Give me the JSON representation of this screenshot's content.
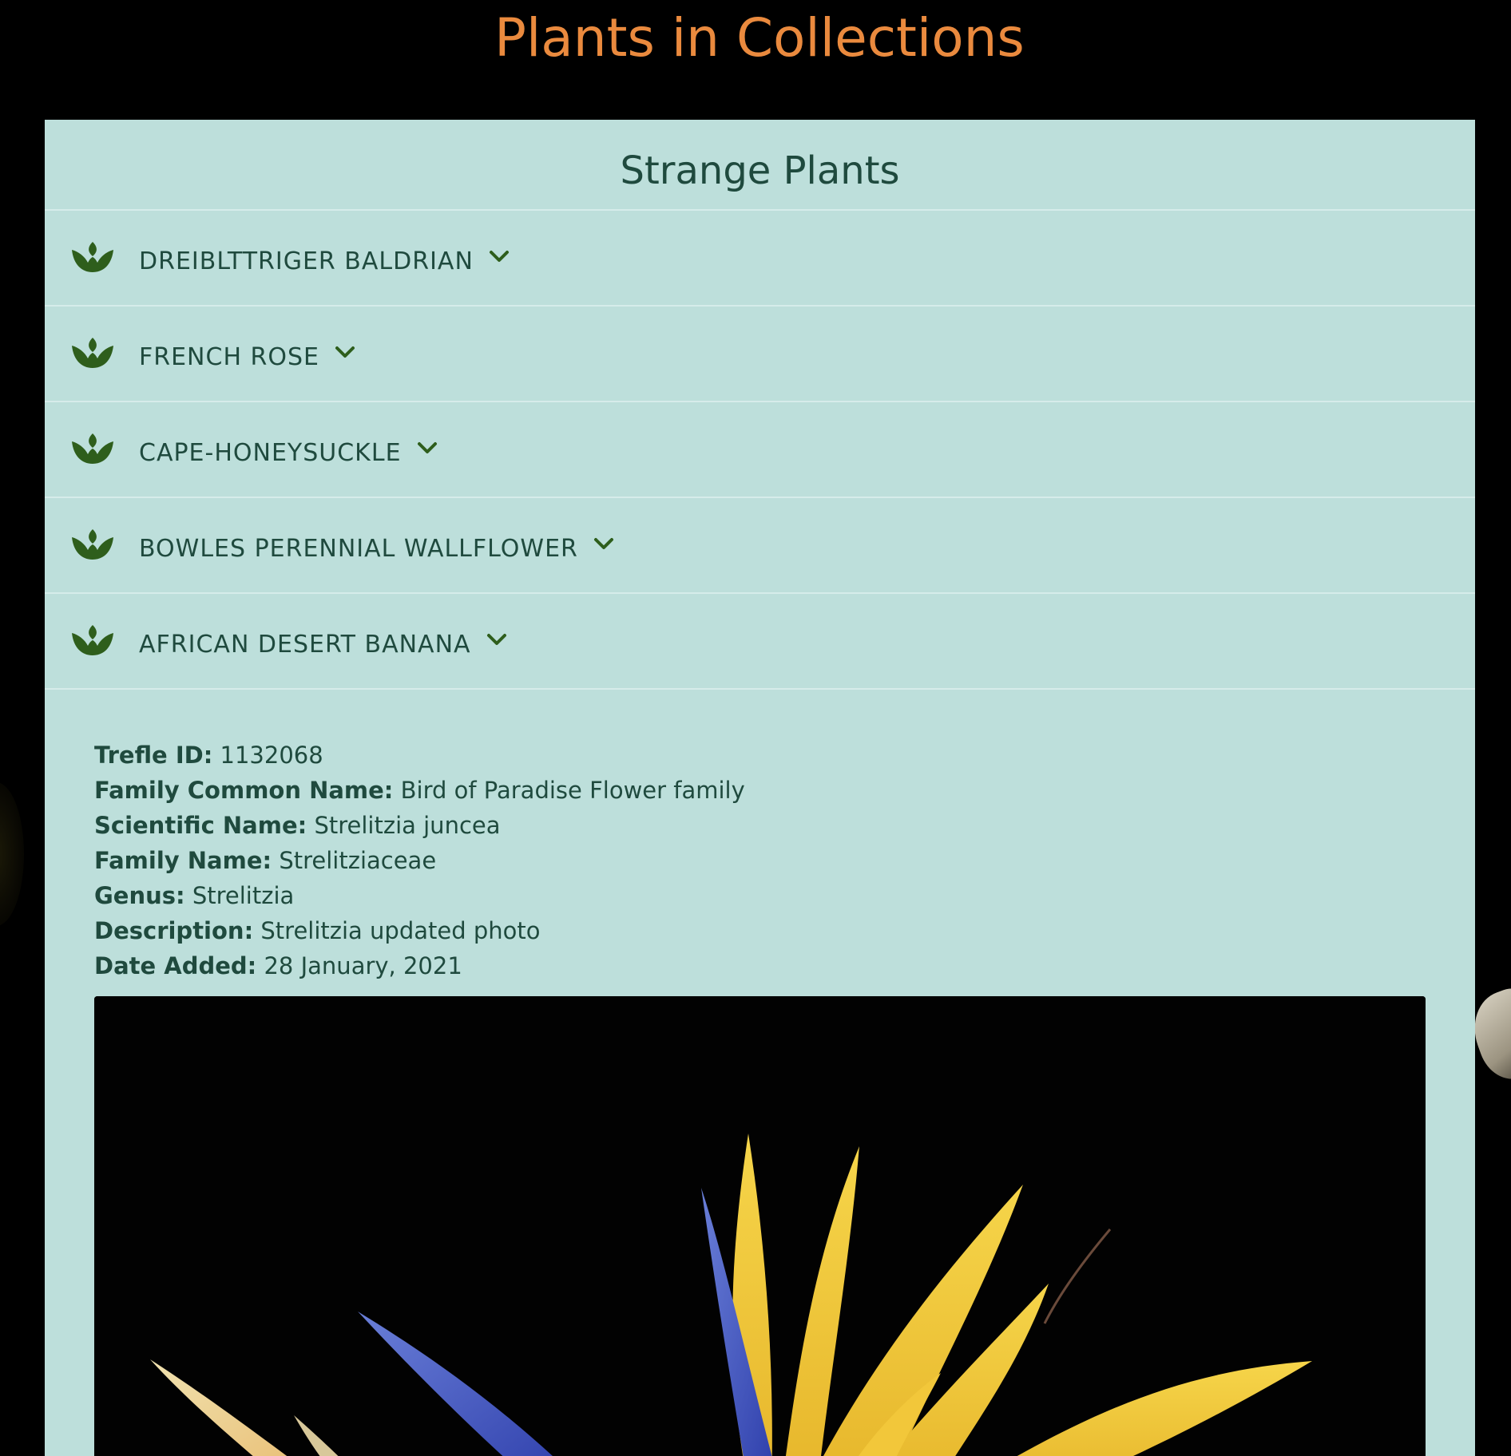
{
  "page": {
    "title": "Plants in Collections"
  },
  "collection": {
    "title": "Strange Plants",
    "items": [
      {
        "label": "DREIBLTTRIGER BALDRIAN",
        "icon": "plant-icon",
        "expanded": false
      },
      {
        "label": "FRENCH ROSE",
        "icon": "plant-icon",
        "expanded": false
      },
      {
        "label": "CAPE-HONEYSUCKLE",
        "icon": "plant-icon",
        "expanded": false
      },
      {
        "label": "BOWLES PERENNIAL WALLFLOWER",
        "icon": "plant-icon",
        "expanded": false
      },
      {
        "label": "AFRICAN DESERT BANANA",
        "icon": "plant-icon",
        "expanded": true
      }
    ]
  },
  "details": {
    "trefle_id": {
      "label": "Trefle ID:",
      "value": "1132068"
    },
    "family_common_name": {
      "label": "Family Common Name:",
      "value": "Bird of Paradise Flower family"
    },
    "scientific_name": {
      "label": "Scientific Name:",
      "value": "Strelitzia juncea"
    },
    "family_name": {
      "label": "Family Name:",
      "value": "Strelitziaceae"
    },
    "genus": {
      "label": "Genus:",
      "value": "Strelitzia"
    },
    "description": {
      "label": "Description:",
      "value": "Strelitzia updated photo"
    },
    "date_added": {
      "label": "Date Added:",
      "value": "28 January, 2021"
    }
  },
  "colors": {
    "title_orange": "#ea8a3e",
    "card_bg": "#bddfdb",
    "text_dark_green": "#1f4a3e",
    "icon_green": "#2e5e1c",
    "page_bg": "#000000"
  },
  "icons": {
    "plant": "plant-icon",
    "chevron": "chevron-down-icon"
  }
}
